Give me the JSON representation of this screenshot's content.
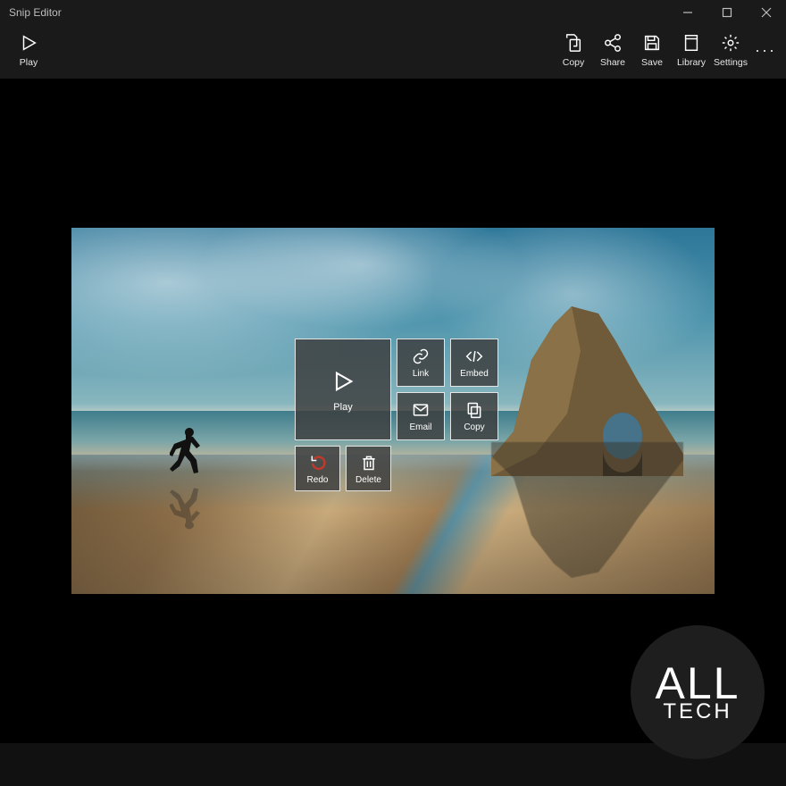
{
  "window": {
    "title": "Snip Editor"
  },
  "commandbar": {
    "play": "Play",
    "copy": "Copy",
    "share": "Share",
    "save": "Save",
    "library": "Library",
    "settings": "Settings"
  },
  "overlay": {
    "play": "Play",
    "link": "Link",
    "embed": "Embed",
    "email": "Email",
    "copy": "Copy",
    "redo": "Redo",
    "delete": "Delete"
  },
  "watermark": {
    "line1": "ALL",
    "line2": "TECH"
  }
}
